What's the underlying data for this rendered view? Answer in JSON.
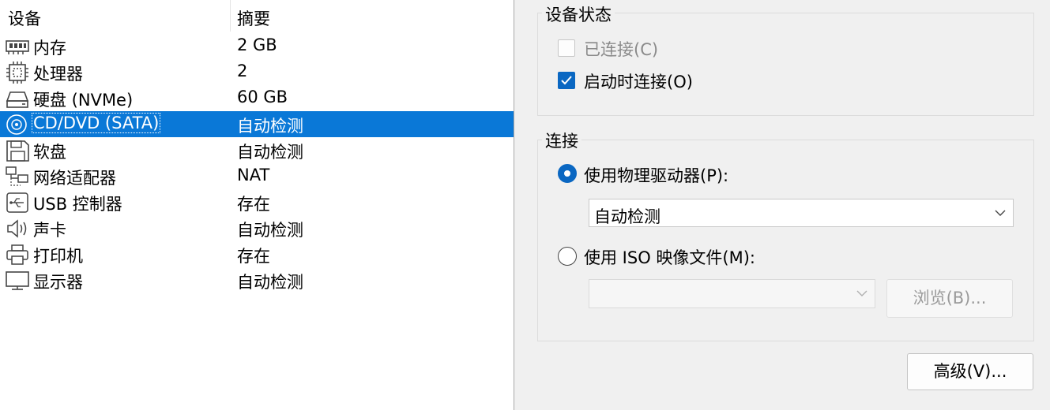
{
  "device_list": {
    "headers": {
      "device": "设备",
      "summary": "摘要"
    },
    "rows": [
      {
        "name": "内存",
        "summary": "2 GB",
        "icon": "memory-icon"
      },
      {
        "name": "处理器",
        "summary": "2",
        "icon": "processor-icon"
      },
      {
        "name": "硬盘 (NVMe)",
        "summary": "60 GB",
        "icon": "hard-disk-icon"
      },
      {
        "name": "CD/DVD (SATA)",
        "summary": "自动检测",
        "icon": "cd-dvd-icon",
        "selected": true
      },
      {
        "name": "软盘",
        "summary": "自动检测",
        "icon": "floppy-icon"
      },
      {
        "name": "网络适配器",
        "summary": "NAT",
        "icon": "network-adapter-icon"
      },
      {
        "name": "USB 控制器",
        "summary": "存在",
        "icon": "usb-icon"
      },
      {
        "name": "声卡",
        "summary": "自动检测",
        "icon": "speaker-icon"
      },
      {
        "name": "打印机",
        "summary": "存在",
        "icon": "printer-icon"
      },
      {
        "name": "显示器",
        "summary": "自动检测",
        "icon": "monitor-icon"
      }
    ]
  },
  "device_status": {
    "title": "设备状态",
    "connected_label": "已连接(C)",
    "connected_checked": false,
    "connected_enabled": false,
    "connect_at_power_on_label": "启动时连接(O)",
    "connect_at_power_on_checked": true
  },
  "connection": {
    "title": "连接",
    "physical_label": "使用物理驱动器(P):",
    "physical_selected": true,
    "physical_value": "自动检测",
    "iso_label": "使用 ISO 映像文件(M):",
    "iso_selected": false,
    "iso_value": "",
    "browse_label": "浏览(B)..."
  },
  "advanced_label": "高级(V)...",
  "colors": {
    "selection": "#0a78d7",
    "accent": "#0a67c2"
  }
}
